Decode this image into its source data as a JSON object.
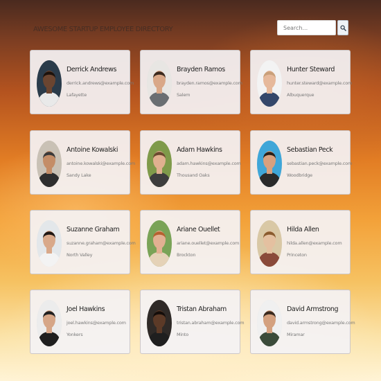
{
  "header": {
    "title": "Awesome Startup Employee Directory",
    "search_placeholder": "Search...",
    "search_value": "",
    "search_icon": "magnifier-icon"
  },
  "employees": [
    {
      "name": "Derrick Andrews",
      "email": "derrick.andrews@example.com",
      "city": "Lafayette",
      "avatar": {
        "bg": "#2a3b4a",
        "skin": "#6b4530",
        "hair": "#1c120c",
        "shirt": "#e9e9e9"
      }
    },
    {
      "name": "Brayden Ramos",
      "email": "brayden.ramos@example.com",
      "city": "Salem",
      "avatar": {
        "bg": "#e8e6e3",
        "skin": "#d9a888",
        "hair": "#3b2a1e",
        "shirt": "#6a6e72"
      }
    },
    {
      "name": "Hunter Steward",
      "email": "hunter.steward@example.com",
      "city": "Albuquerque",
      "avatar": {
        "bg": "#f3f3f3",
        "skin": "#e6b99b",
        "hair": "#c9a07a",
        "shirt": "#34476a"
      }
    },
    {
      "name": "Antoine Kowalski",
      "email": "antoine.kowalski@example.com",
      "city": "Sandy Lake",
      "avatar": {
        "bg": "#c9c1b5",
        "skin": "#c48d67",
        "hair": "#3a3a3a",
        "shirt": "#2e2e2e"
      }
    },
    {
      "name": "Adam Hawkins",
      "email": "adam.hawkins@example.com",
      "city": "Thousand Oaks",
      "avatar": {
        "bg": "#7f9a4a",
        "skin": "#e0b08f",
        "hair": "#6b4a2f",
        "shirt": "#3d3d3d"
      }
    },
    {
      "name": "Sebastian Peck",
      "email": "sebastian.peck@example.com",
      "city": "Woodbridge",
      "avatar": {
        "bg": "#3fa6d8",
        "skin": "#d8a07e",
        "hair": "#2a1f17",
        "shirt": "#2a2a2a"
      }
    },
    {
      "name": "Suzanne Graham",
      "email": "suzanne.graham@example.com",
      "city": "North Valley",
      "avatar": {
        "bg": "#e3e7ea",
        "skin": "#d9a98a",
        "hair": "#1f1713",
        "shirt": "#f3f3f3"
      }
    },
    {
      "name": "Ariane Ouellet",
      "email": "ariane.ouellet@example.com",
      "city": "Brockton",
      "avatar": {
        "bg": "#7aa357",
        "skin": "#e2b092",
        "hair": "#b5612f",
        "shirt": "#e5d2b7"
      }
    },
    {
      "name": "Hilda Allen",
      "email": "hilda.allen@example.com",
      "city": "Princeton",
      "avatar": {
        "bg": "#d9c8a5",
        "skin": "#e4c0a0",
        "hair": "#8a5b2e",
        "shirt": "#8a4a3a"
      }
    },
    {
      "name": "Joel Hawkins",
      "email": "joel.hawkins@example.com",
      "city": "Yonkers",
      "avatar": {
        "bg": "#ececec",
        "skin": "#d6a687",
        "hair": "#202020",
        "shirt": "#1f1f1f"
      }
    },
    {
      "name": "Tristan Abraham",
      "email": "tristan.abraham@example.com",
      "city": "Minto",
      "avatar": {
        "bg": "#2f2a27",
        "skin": "#5c3a27",
        "hair": "#140d0a",
        "shirt": "#1f1f1f"
      }
    },
    {
      "name": "David Armstrong",
      "email": "david.armstrong@example.com",
      "city": "Miramar",
      "avatar": {
        "bg": "#f0f0f0",
        "skin": "#d4a17f",
        "hair": "#3a2a1e",
        "shirt": "#3b4b3a"
      }
    }
  ]
}
